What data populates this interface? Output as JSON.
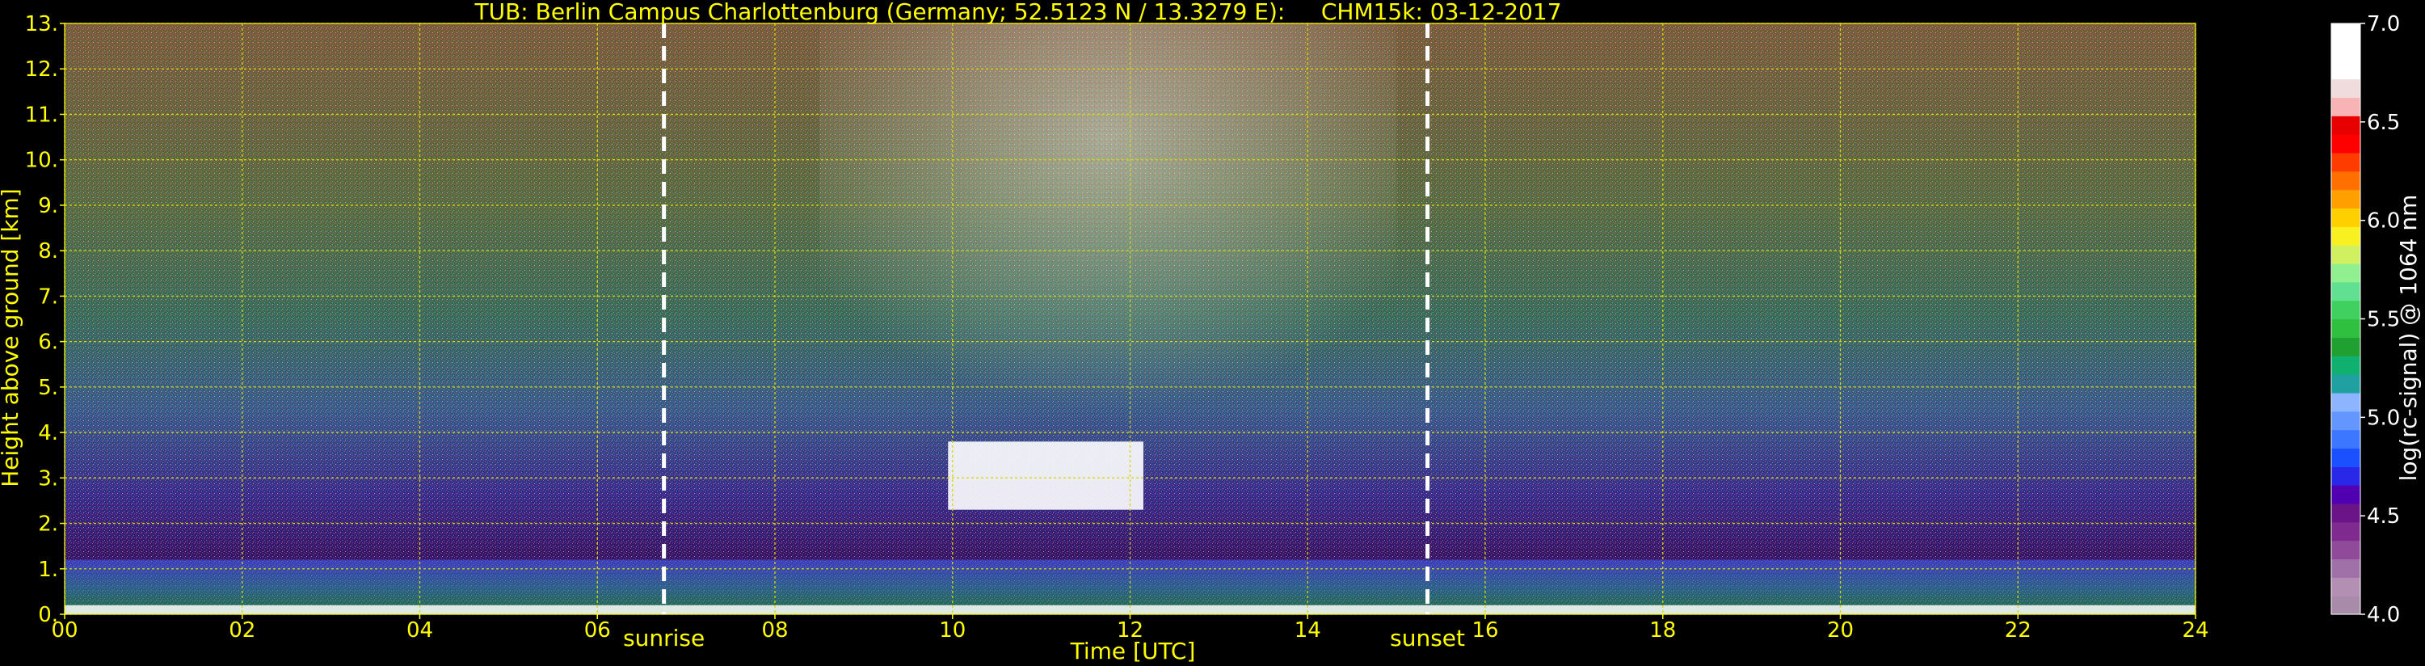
{
  "chart_data": {
    "type": "heatmap",
    "title": "TUB: Berlin Campus Charlottenburg (Germany; 52.5123 N / 13.3279 E):     CHM15k: 03-12-2017",
    "xlabel": "Time [UTC]",
    "ylabel": "Height above ground [km]",
    "xlim": [
      0,
      24
    ],
    "ylim": [
      0,
      13
    ],
    "x_ticks": [
      0,
      2,
      4,
      6,
      8,
      10,
      12,
      14,
      16,
      18,
      20,
      22,
      24
    ],
    "x_tick_labels": [
      "00",
      "02",
      "04",
      "06",
      "08",
      "10",
      "12",
      "14",
      "16",
      "18",
      "20",
      "22",
      "24"
    ],
    "y_ticks": [
      0,
      1,
      2,
      3,
      4,
      5,
      6,
      7,
      8,
      9,
      10,
      11,
      12,
      13
    ],
    "y_tick_labels": [
      "0.",
      "1.",
      "2.",
      "3.",
      "4.",
      "5.",
      "6.",
      "7.",
      "8.",
      "9.",
      "10.",
      "11.",
      "12.",
      "13."
    ],
    "grid": true,
    "annotations": [
      {
        "text": "sunrise",
        "x": 6.75
      },
      {
        "text": "sunset",
        "x": 15.35
      }
    ],
    "colorbar": {
      "label": "log(rc-signal) @ 1064 nm",
      "range": [
        4.0,
        7.0
      ],
      "ticks": [
        4.0,
        4.5,
        5.0,
        5.5,
        6.0,
        6.5,
        7.0
      ],
      "tick_labels": [
        "4.0",
        "4.5",
        "5.0",
        "5.5",
        "6.0",
        "6.5",
        "7.0"
      ],
      "colors": [
        "#a88ba8",
        "#b48fb4",
        "#a070a8",
        "#904a9a",
        "#7e2a8e",
        "#6a1488",
        "#5000b0",
        "#2a28e8",
        "#1a50ff",
        "#3c78ff",
        "#6496ff",
        "#8cb4ff",
        "#20a0a0",
        "#10b070",
        "#20a030",
        "#30c040",
        "#40d060",
        "#60e090",
        "#90f090",
        "#d0f060",
        "#f8f020",
        "#ffd000",
        "#ffa000",
        "#ff7000",
        "#ff3c00",
        "#ff0000",
        "#e80000",
        "#f8b4b4",
        "#f0dcdc",
        "#ffffff",
        "#ffffff",
        "#ffffff"
      ]
    },
    "features": [
      {
        "name": "cloud",
        "x": [
          9.95,
          12.15
        ],
        "y": [
          2.3,
          3.8
        ],
        "value": 7.0
      },
      {
        "name": "boundary layer",
        "x": [
          0,
          24
        ],
        "y": [
          0,
          1.2
        ],
        "value": 5.0
      }
    ]
  }
}
